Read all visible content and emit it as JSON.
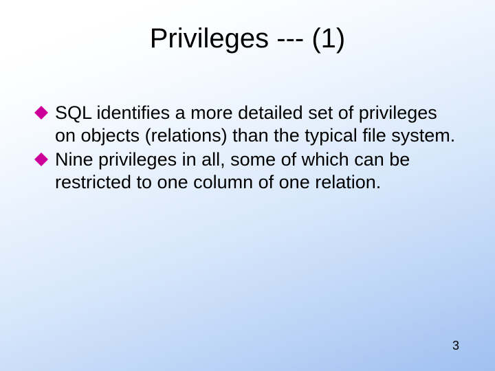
{
  "slide": {
    "title": "Privileges --- (1)",
    "bullets": [
      "SQL identifies a more detailed set of privileges on objects (relations) than the typical file system.",
      "Nine privileges in all, some of which can be restricted to one column of one relation."
    ],
    "page_number": "3"
  },
  "colors": {
    "bullet_fill": "#cc0099"
  }
}
